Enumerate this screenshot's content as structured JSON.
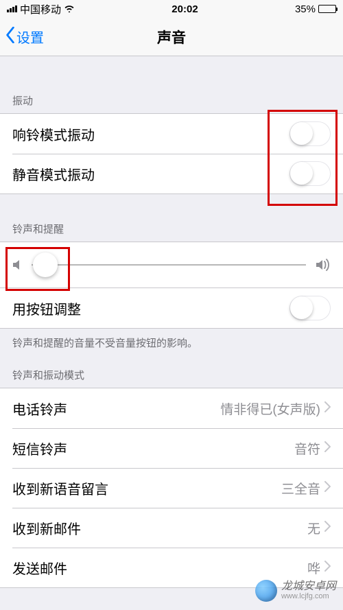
{
  "status": {
    "carrier": "中国移动",
    "time": "20:02",
    "battery_pct": "35%"
  },
  "nav": {
    "back_label": "设置",
    "title": "声音"
  },
  "sections": {
    "vibration": {
      "header": "振动",
      "ring_on_vibrate": "响铃模式振动",
      "silent_vibrate": "静音模式振动"
    },
    "ringer": {
      "header": "铃声和提醒",
      "change_with_buttons": "用按钮调整",
      "footer": "铃声和提醒的音量不受音量按钮的影响。"
    },
    "sounds_patterns": {
      "header": "铃声和振动模式",
      "items": [
        {
          "label": "电话铃声",
          "value": "情非得已(女声版)"
        },
        {
          "label": "短信铃声",
          "value": "音符"
        },
        {
          "label": "收到新语音留言",
          "value": "三全音"
        },
        {
          "label": "收到新邮件",
          "value": "无"
        },
        {
          "label": "发送邮件",
          "value": "哗"
        }
      ]
    }
  },
  "watermark": {
    "name": "龙城安卓网",
    "url": "www.lcjfg.com"
  }
}
